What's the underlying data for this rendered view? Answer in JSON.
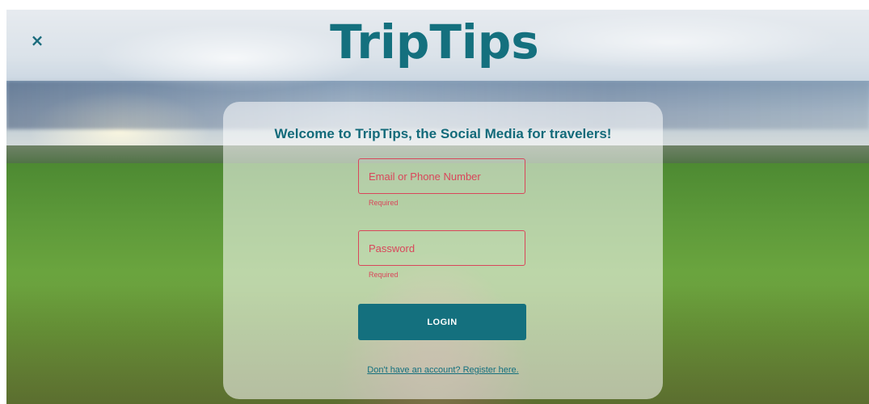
{
  "header": {
    "close_icon": "×",
    "logo": "TripTips"
  },
  "card": {
    "welcome": "Welcome to TripTips, the Social Media for travelers!",
    "email": {
      "placeholder": "Email or Phone Number",
      "value": "",
      "error": "Required"
    },
    "password": {
      "placeholder": "Password",
      "value": "",
      "error": "Required"
    },
    "login_label": "LOGIN",
    "register_link": "Don't have an account? Register here."
  },
  "colors": {
    "brand": "#14707e",
    "error": "#d9465a"
  },
  "icons": [
    "close-icon"
  ]
}
